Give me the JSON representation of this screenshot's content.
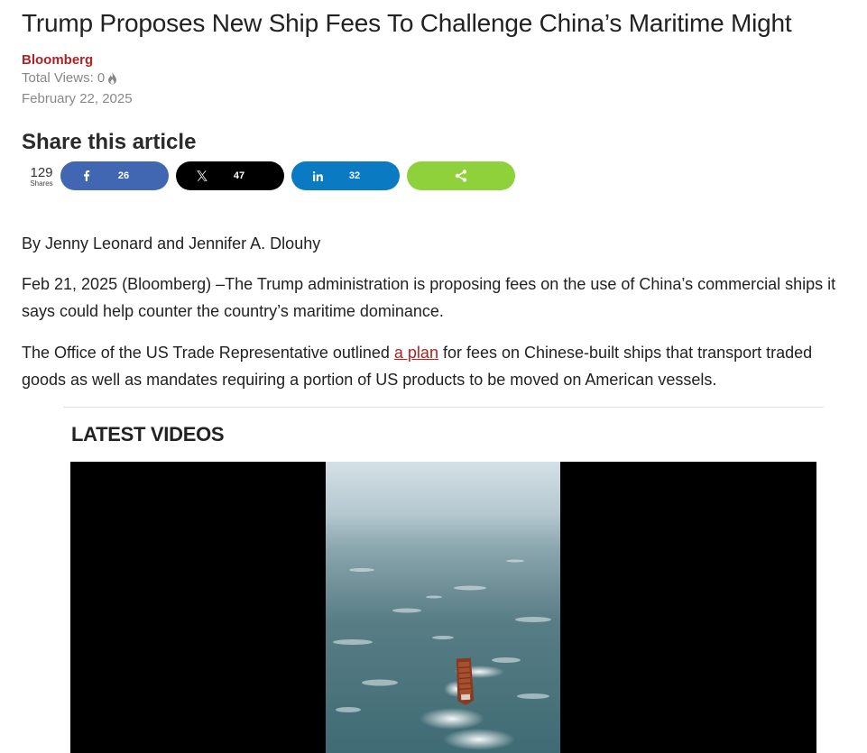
{
  "article": {
    "title": "Trump Proposes New Ship Fees To Challenge China’s Maritime Might",
    "source": "Bloomberg",
    "views_label": "Total Views: 0",
    "date": "February 22, 2025"
  },
  "share": {
    "heading": "Share this article",
    "total": "129",
    "total_label": "Shares",
    "buttons": [
      {
        "network": "facebook",
        "icon": "facebook-icon",
        "count": "26",
        "color": "#4267b2"
      },
      {
        "network": "x",
        "icon": "x-icon",
        "count": "47",
        "color": "#000000"
      },
      {
        "network": "linkedin",
        "icon": "linkedin-icon",
        "count": "32",
        "color": "#0a7bc2"
      },
      {
        "network": "share",
        "icon": "share-icon",
        "count": "",
        "color": "#8ed13a"
      }
    ]
  },
  "body": {
    "byline": "By Jenny Leonard and Jennifer A. Dlouhy",
    "para1": "Feb 21, 2025 (Bloomberg) –The Trump administration is proposing fees on the use of China’s commercial ships it says could help counter the country’s maritime dominance.",
    "para2_before": "The Office of the US Trade Representative outlined ",
    "para2_link": "a plan",
    "para2_after": " for fees on Chinese-built ships that transport traded goods as well as mandates requiring a portion of US products to be moved on American vessels."
  },
  "videos": {
    "heading": "LATEST VIDEOS"
  },
  "colors": {
    "accent": "#b22222",
    "muted": "#888888"
  }
}
